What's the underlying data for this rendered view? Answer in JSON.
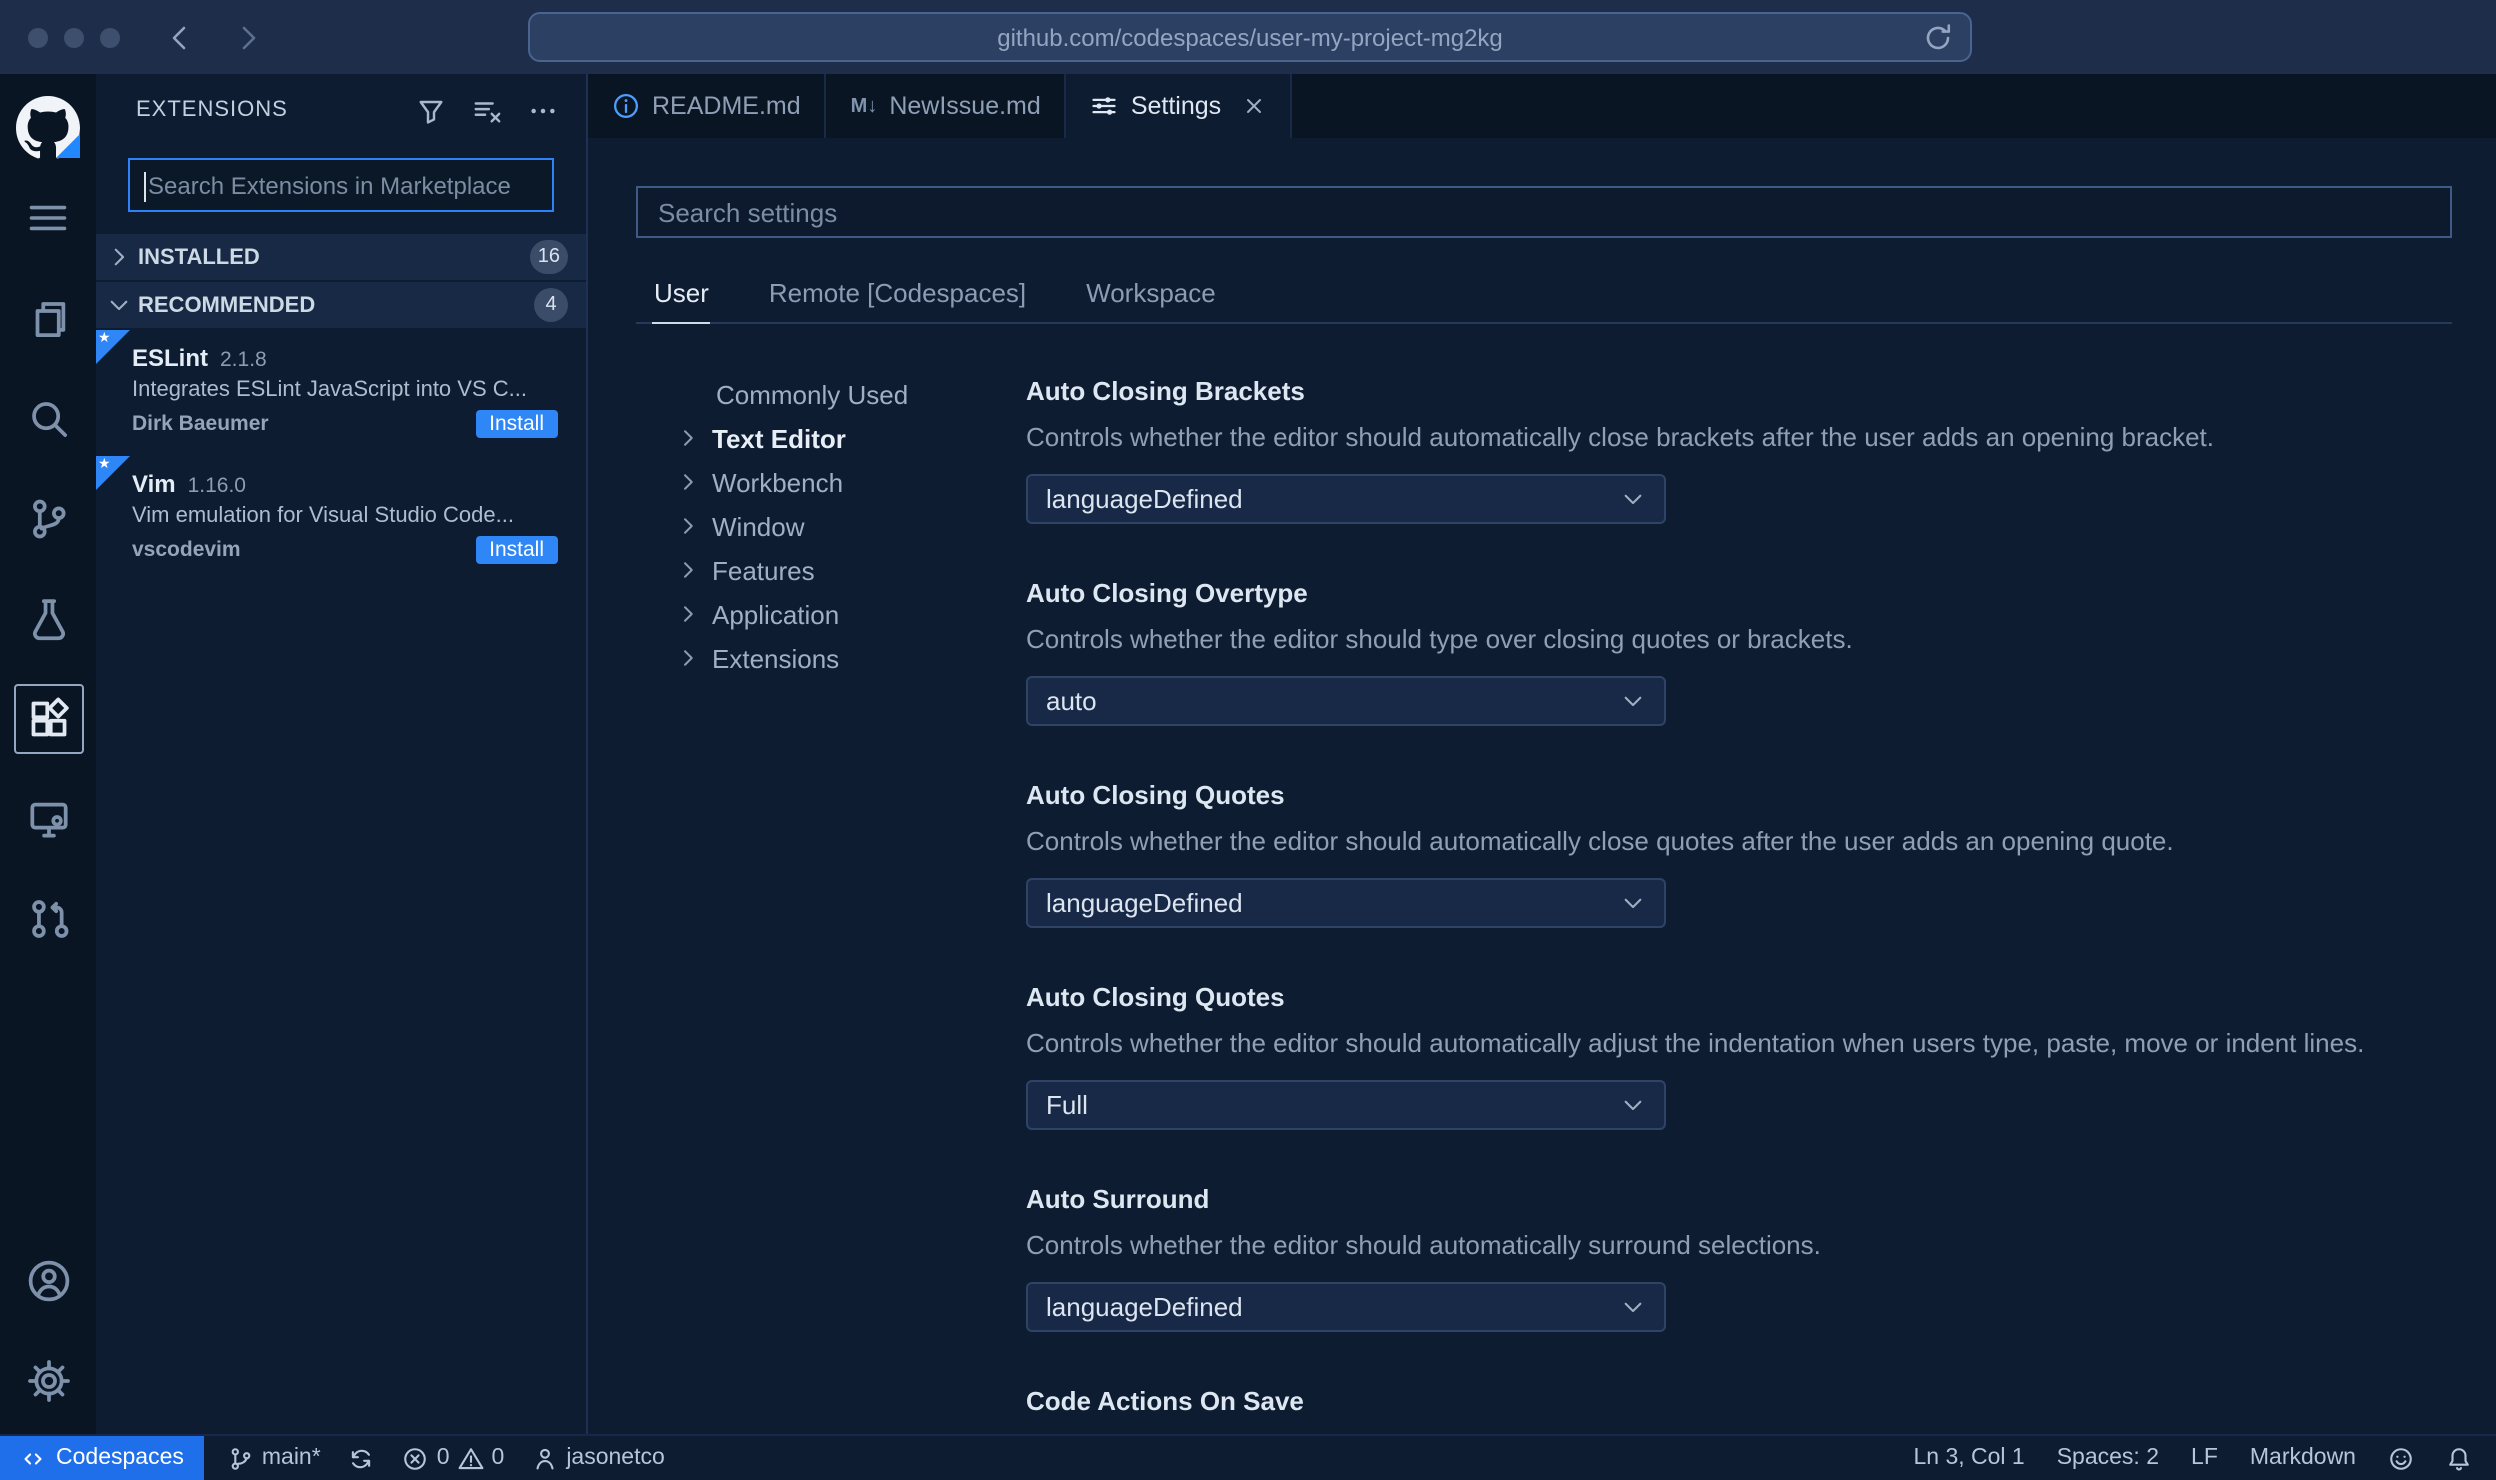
{
  "browser": {
    "url": "github.com/codespaces/user-my-project-mg2kg"
  },
  "colors": {
    "accent": "#2f81f7",
    "install_button": "#2f86f6",
    "status_blue": "#1f6feb",
    "flag_blue": "#2188ff"
  },
  "icons": {
    "browser": [
      "traffic-dots",
      "back",
      "forward",
      "refresh"
    ],
    "activity_bar": [
      "github-logo",
      "menu",
      "files",
      "search",
      "source-control",
      "beaker",
      "extensions",
      "remote-explorer",
      "git-pull-request",
      "account",
      "gear"
    ],
    "sidebar_header": [
      "filter",
      "clear-search-results",
      "more-actions"
    ],
    "tab_icons": [
      "info",
      "markdown",
      "settings-sliders",
      "close"
    ],
    "status_bar": [
      "codespaces-remote",
      "git-branch",
      "sync",
      "error",
      "warning",
      "person",
      "feedback",
      "bell"
    ]
  },
  "sidebar": {
    "title": "EXTENSIONS",
    "search_placeholder": "Search Extensions in Marketplace",
    "sections": [
      {
        "label": "INSTALLED",
        "count": "16"
      },
      {
        "label": "RECOMMENDED",
        "count": "4"
      }
    ],
    "extensions": [
      {
        "name": "ESLint",
        "version": "2.1.8",
        "description": "Integrates ESLint JavaScript into VS C...",
        "author": "Dirk Baeumer",
        "action": "Install"
      },
      {
        "name": "Vim",
        "version": "1.16.0",
        "description": "Vim emulation for Visual Studio Code...",
        "author": "vscodevim",
        "action": "Install"
      }
    ]
  },
  "tabs": [
    {
      "label": "README.md",
      "icon": "info-icon"
    },
    {
      "label": "NewIssue.md",
      "icon": "markdown-icon",
      "glyph": "M↓"
    },
    {
      "label": "Settings",
      "icon": "settings-sliders-icon",
      "closable": true,
      "active": true
    }
  ],
  "settings": {
    "search_placeholder": "Search settings",
    "scopes": [
      "User",
      "Remote [Codespaces]",
      "Workspace"
    ],
    "toc": [
      "Commonly Used",
      "Text Editor",
      "Workbench",
      "Window",
      "Features",
      "Application",
      "Extensions"
    ],
    "items": [
      {
        "title": "Auto Closing Brackets",
        "description": "Controls whether the editor should automatically close brackets after the user adds an opening bracket.",
        "value": "languageDefined"
      },
      {
        "title": "Auto Closing Overtype",
        "description": "Controls whether the editor should type over closing quotes or brackets.",
        "value": "auto"
      },
      {
        "title": "Auto Closing Quotes",
        "description": "Controls whether the editor should automatically close quotes after the user adds an opening quote.",
        "value": "languageDefined"
      },
      {
        "title": "Auto Closing Quotes",
        "description": "Controls whether the editor should automatically adjust the indentation when users type, paste, move or indent lines.",
        "value": "Full"
      },
      {
        "title": "Auto Surround",
        "description": "Controls whether the editor should automatically surround selections.",
        "value": "languageDefined"
      },
      {
        "title": "Code Actions On Save"
      }
    ]
  },
  "status": {
    "codespaces": "Codespaces",
    "branch": "main*",
    "errors": "0",
    "warnings": "0",
    "user": "jasonetco",
    "line": "Ln 3, Col 1",
    "indent": "Spaces: 2",
    "eol": "LF",
    "language": "Markdown"
  }
}
